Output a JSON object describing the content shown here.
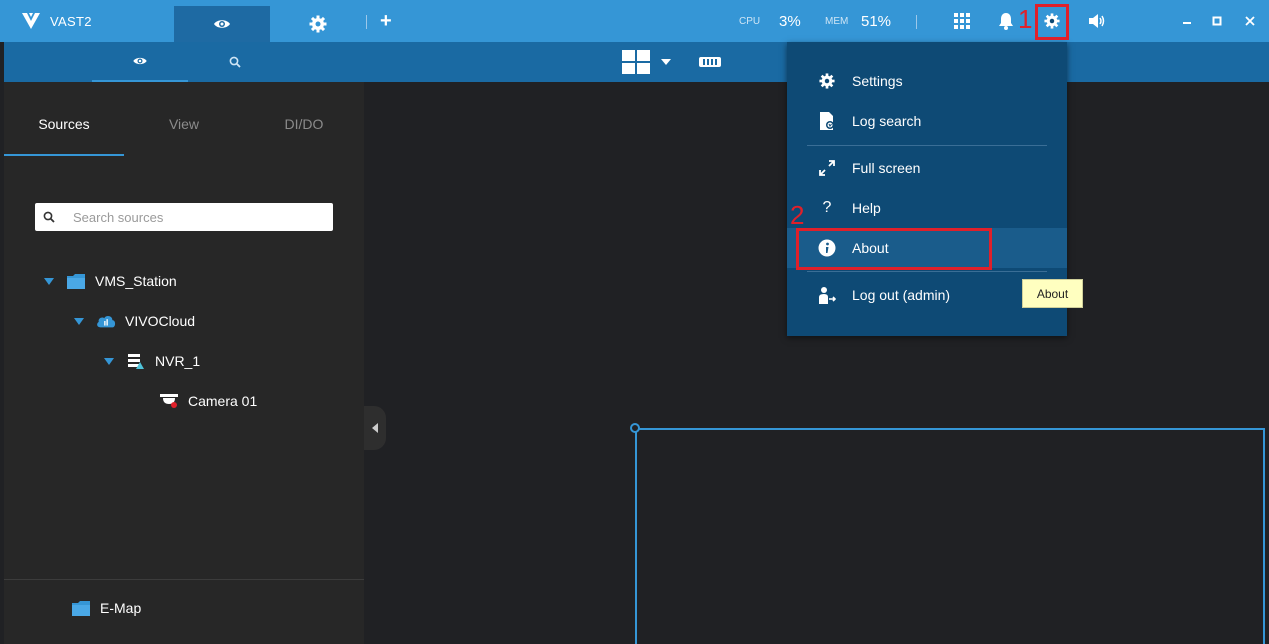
{
  "app": {
    "name": "VAST2"
  },
  "topbar": {
    "cpu_label": "CPU",
    "cpu_value": "3%",
    "mem_label": "MEM",
    "mem_value": "51%",
    "add_label": "+"
  },
  "left_panel": {
    "tabs": [
      {
        "label": "Sources",
        "active": true
      },
      {
        "label": "View",
        "active": false
      },
      {
        "label": "DI/DO",
        "active": false
      }
    ],
    "search_placeholder": "Search sources",
    "tree": [
      {
        "label": "VMS_Station",
        "icon": "folder-icon"
      },
      {
        "label": "VIVOCloud",
        "icon": "cloud-icon"
      },
      {
        "label": "NVR_1",
        "icon": "nvr-icon"
      },
      {
        "label": "Camera 01",
        "icon": "camera-icon"
      }
    ],
    "emap_label": "E-Map"
  },
  "menu": {
    "items": [
      {
        "label": "Settings",
        "icon": "gear-icon"
      },
      {
        "label": "Log search",
        "icon": "log-search-icon"
      },
      {
        "label": "Full screen",
        "icon": "fullscreen-icon"
      },
      {
        "label": "Help",
        "icon": "help-icon"
      },
      {
        "label": "About",
        "icon": "info-icon"
      },
      {
        "label": "Log out (admin)",
        "icon": "logout-icon"
      }
    ]
  },
  "tooltip": {
    "text": "About"
  },
  "annotations": {
    "step1": "1",
    "step2": "2"
  },
  "colors": {
    "topbar": "#3596d6",
    "subbar": "#1a6aa3",
    "menu_bg": "#0e4a75",
    "annotation": "#e0202a",
    "tooltip_bg": "#ffffc0"
  }
}
